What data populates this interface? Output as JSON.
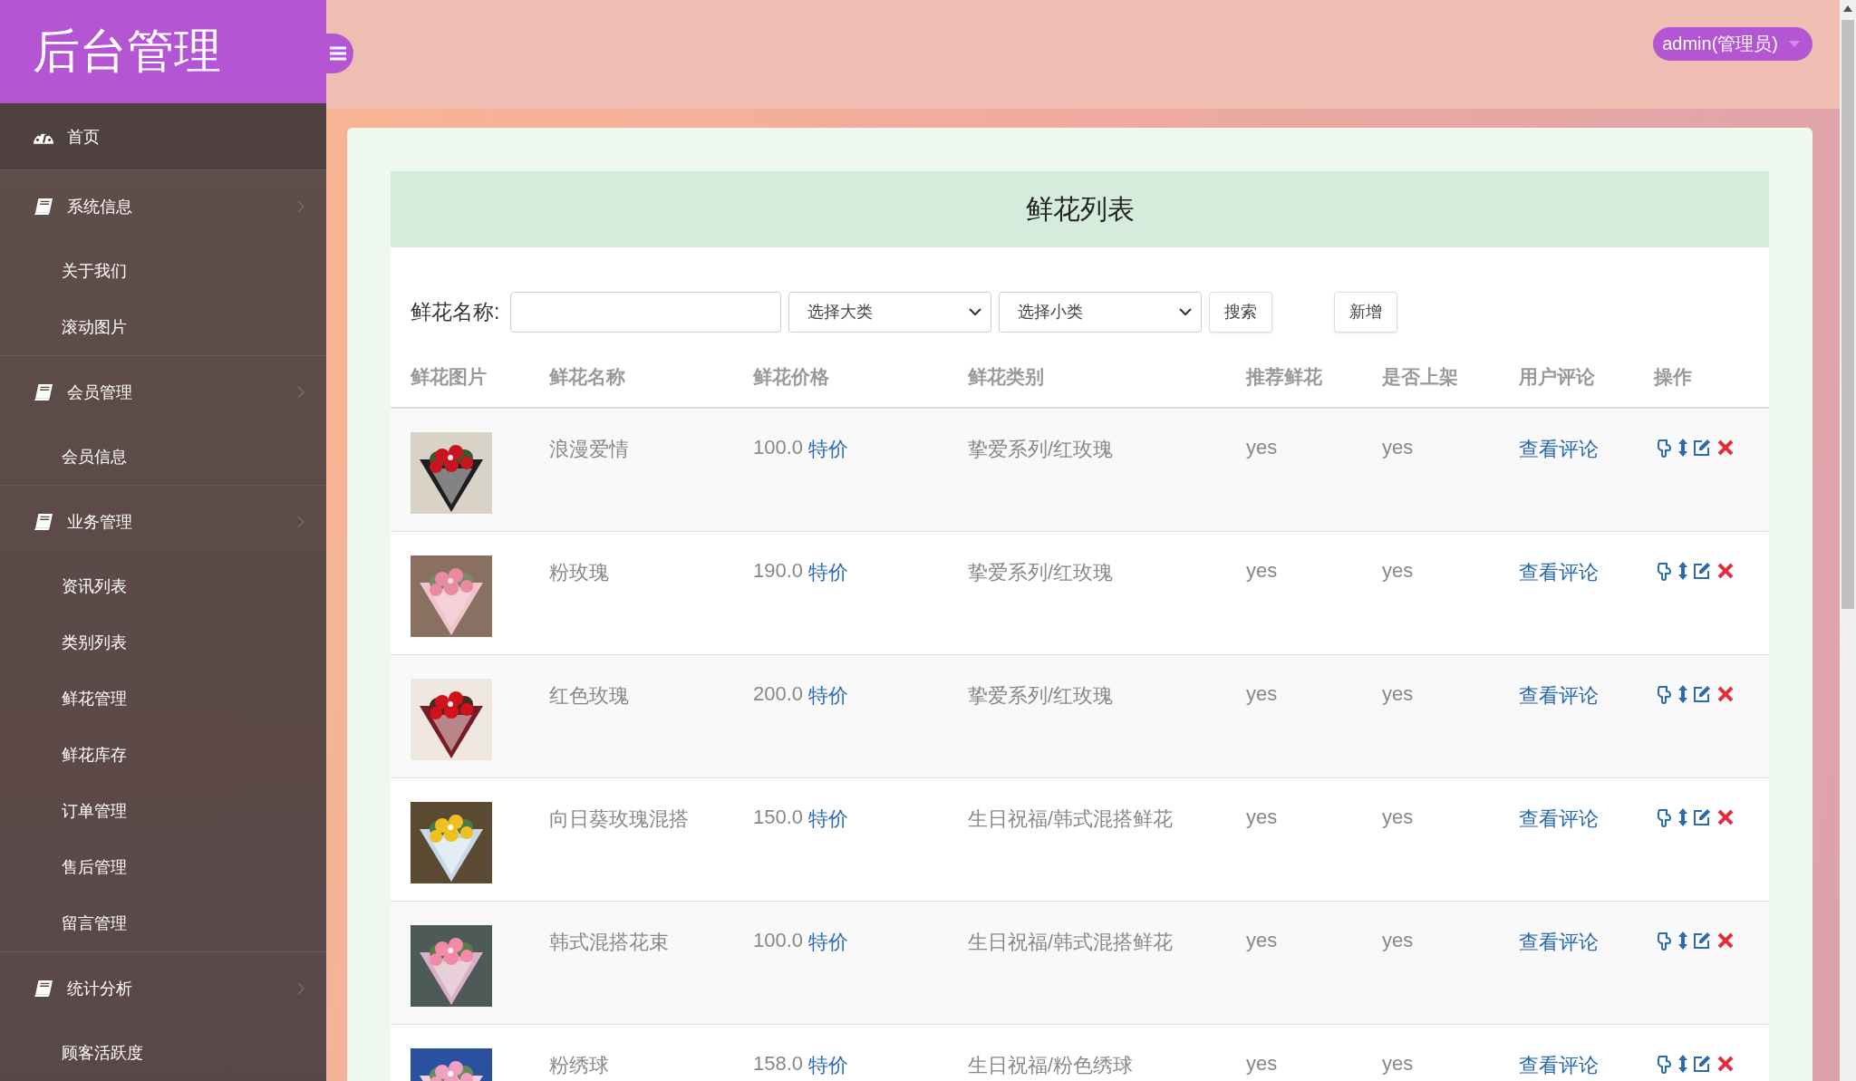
{
  "sidebar": {
    "title": "后台管理",
    "items": [
      {
        "label": "首页",
        "kind": "home",
        "selected": true
      },
      {
        "label": "系统信息",
        "kind": "group",
        "selected": false,
        "children": [
          {
            "label": "关于我们",
            "selected": false
          },
          {
            "label": "滚动图片",
            "selected": false
          }
        ]
      },
      {
        "label": "会员管理",
        "kind": "group",
        "selected": false,
        "children": [
          {
            "label": "会员信息",
            "selected": false
          }
        ]
      },
      {
        "label": "业务管理",
        "kind": "group",
        "selected": false,
        "children": [
          {
            "label": "资讯列表",
            "selected": false
          },
          {
            "label": "类别列表",
            "selected": false
          },
          {
            "label": "鲜花管理",
            "selected": false
          },
          {
            "label": "鲜花库存",
            "selected": false
          },
          {
            "label": "订单管理",
            "selected": false
          },
          {
            "label": "售后管理",
            "selected": false
          },
          {
            "label": "留言管理",
            "selected": false
          }
        ]
      },
      {
        "label": "统计分析",
        "kind": "group",
        "selected": false,
        "children": [
          {
            "label": "顾客活跃度",
            "selected": false
          }
        ]
      }
    ]
  },
  "header": {
    "user": "admin(管理员)"
  },
  "panel": {
    "title": "鲜花列表",
    "filter": {
      "label": "鲜花名称:",
      "selects": [
        {
          "value": "选择大类"
        },
        {
          "value": "选择小类"
        }
      ],
      "buttons": [
        "搜索",
        "新增"
      ]
    },
    "table": {
      "columns": [
        "鲜花图片",
        "鲜花名称",
        "鲜花价格",
        "鲜花类别",
        "推荐鲜花",
        "是否上架",
        "用户评论",
        "操作"
      ],
      "rows": [
        {
          "name": "浪漫爱情",
          "price": "100.0",
          "price_tag": "特价",
          "category": "挚爱系列/红玫瑰",
          "recommended": "yes",
          "on_shelf": "yes",
          "comments": "查看评论"
        },
        {
          "name": "粉玫瑰",
          "price": "190.0",
          "price_tag": "特价",
          "category": "挚爱系列/红玫瑰",
          "recommended": "yes",
          "on_shelf": "yes",
          "comments": "查看评论"
        },
        {
          "name": "红色玫瑰",
          "price": "200.0",
          "price_tag": "特价",
          "category": "挚爱系列/红玫瑰",
          "recommended": "yes",
          "on_shelf": "yes",
          "comments": "查看评论"
        },
        {
          "name": "向日葵玫瑰混搭",
          "price": "150.0",
          "price_tag": "特价",
          "category": "生日祝福/韩式混搭鲜花",
          "recommended": "yes",
          "on_shelf": "yes",
          "comments": "查看评论"
        },
        {
          "name": "韩式混搭花束",
          "price": "100.0",
          "price_tag": "特价",
          "category": "生日祝福/韩式混搭鲜花",
          "recommended": "yes",
          "on_shelf": "yes",
          "comments": "查看评论"
        },
        {
          "name": "粉绣球",
          "price": "158.0",
          "price_tag": "特价",
          "category": "生日祝福/粉色绣球",
          "recommended": "yes",
          "on_shelf": "yes",
          "comments": "查看评论"
        }
      ]
    }
  }
}
